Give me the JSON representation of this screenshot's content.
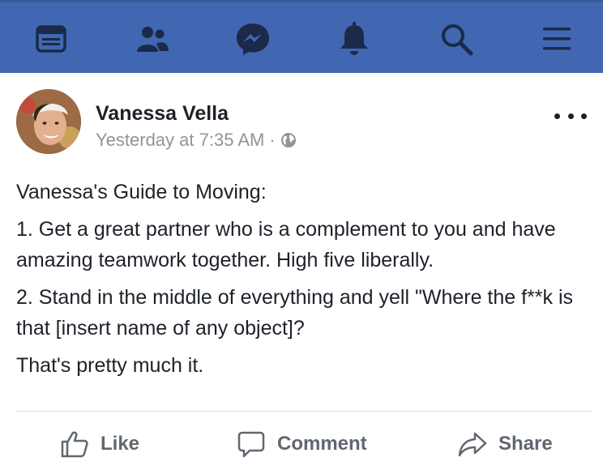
{
  "nav": {
    "items": [
      {
        "name": "news-feed-icon"
      },
      {
        "name": "friends-icon"
      },
      {
        "name": "messenger-icon"
      },
      {
        "name": "notifications-icon"
      },
      {
        "name": "search-icon"
      },
      {
        "name": "menu-icon"
      }
    ],
    "bar_color": "#4267b2"
  },
  "post": {
    "author": "Vanessa Vella",
    "timestamp": "Yesterday at 7:35 AM",
    "separator": "·",
    "privacy_icon": "globe-icon",
    "paragraphs": [
      "Vanessa's Guide to Moving:",
      "1. Get a great partner who is a complement to you and have amazing teamwork together. High five liberally.",
      "2. Stand in the middle of everything and yell \"Where the f**k is that [insert name of any object]?",
      "That's pretty much it."
    ]
  },
  "actions": {
    "like": "Like",
    "comment": "Comment",
    "share": "Share"
  }
}
